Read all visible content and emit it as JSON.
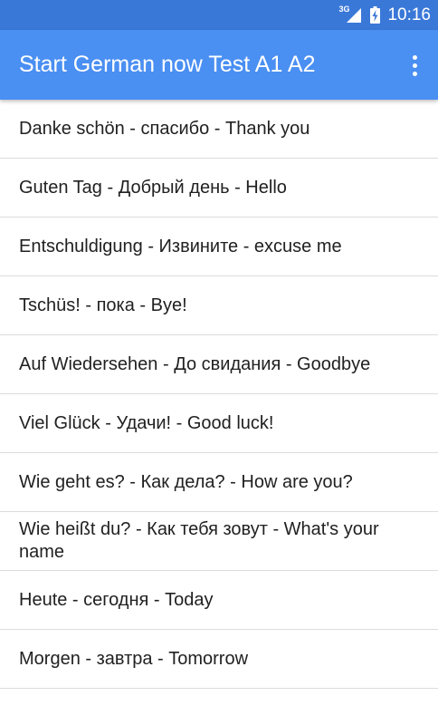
{
  "status_bar": {
    "network_type": "3G",
    "time": "10:16",
    "icons": [
      "signal-icon",
      "battery-icon"
    ]
  },
  "app_bar": {
    "title": "Start German now Test A1 A2",
    "menu_icon": "more-vert-icon"
  },
  "phrases": [
    "Danke schön - спасибо - Thank you",
    "Guten Tag - Добрый день - Hello",
    "Entschuldigung - Извините - excuse me",
    "Tschüs! - пока - Bye!",
    "Auf Wiedersehen - До свидания - Goodbye",
    "Viel Glück - Удачи! - Good luck!",
    "Wie geht es? - Как дела? - How are you?",
    "Wie heißt du? - Как тебя зовут - What's your name",
    "Heute - сегодня - Today",
    "Morgen - завтра - Tomorrow"
  ],
  "colors": {
    "status_bar": "#3a78d8",
    "app_bar": "#4a8ff2",
    "text": "#212121",
    "divider": "#dcdcdc"
  }
}
